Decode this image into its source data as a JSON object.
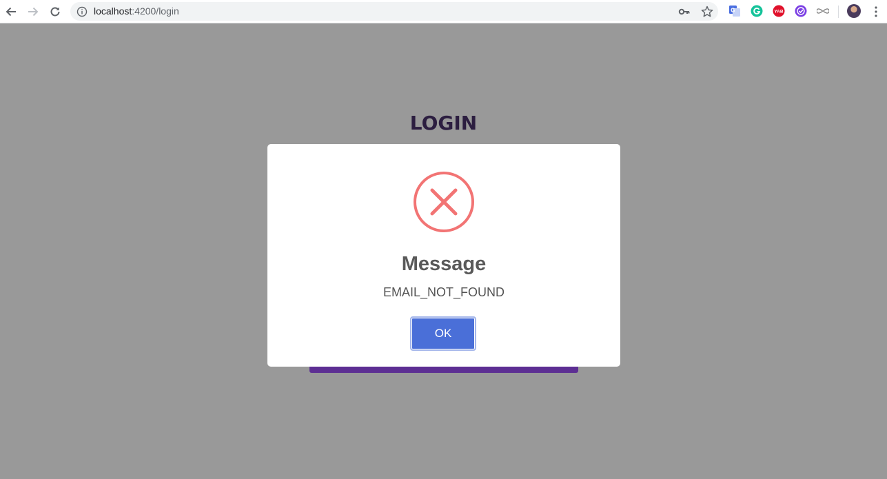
{
  "browser": {
    "url_host": "localhost",
    "url_rest": ":4200/login",
    "icons": {
      "back": "back-arrow-icon",
      "forward": "forward-arrow-icon",
      "reload": "reload-icon",
      "info": "info-icon",
      "key": "key-icon",
      "star": "star-icon",
      "menu": "kebab-menu-icon"
    },
    "extensions": [
      {
        "name": "translate-extension-icon",
        "color": "#4a6ee0"
      },
      {
        "name": "grammarly-extension-icon",
        "color": "#15c39a"
      },
      {
        "name": "yab-extension-icon",
        "color": "#e0112b",
        "label": "YAB"
      },
      {
        "name": "checkmark-extension-icon",
        "color": "#7b3fe4"
      },
      {
        "name": "infinity-extension-icon",
        "color": "#8a8a8a"
      }
    ]
  },
  "page": {
    "title": "LOGIN",
    "overlay_color": "#999999",
    "accent": "#5d2f93"
  },
  "modal": {
    "icon": "error-x-icon",
    "icon_color": "#f27474",
    "title": "Message",
    "text": "EMAIL_NOT_FOUND",
    "button_label": "OK",
    "button_color": "#4a6fd8"
  }
}
